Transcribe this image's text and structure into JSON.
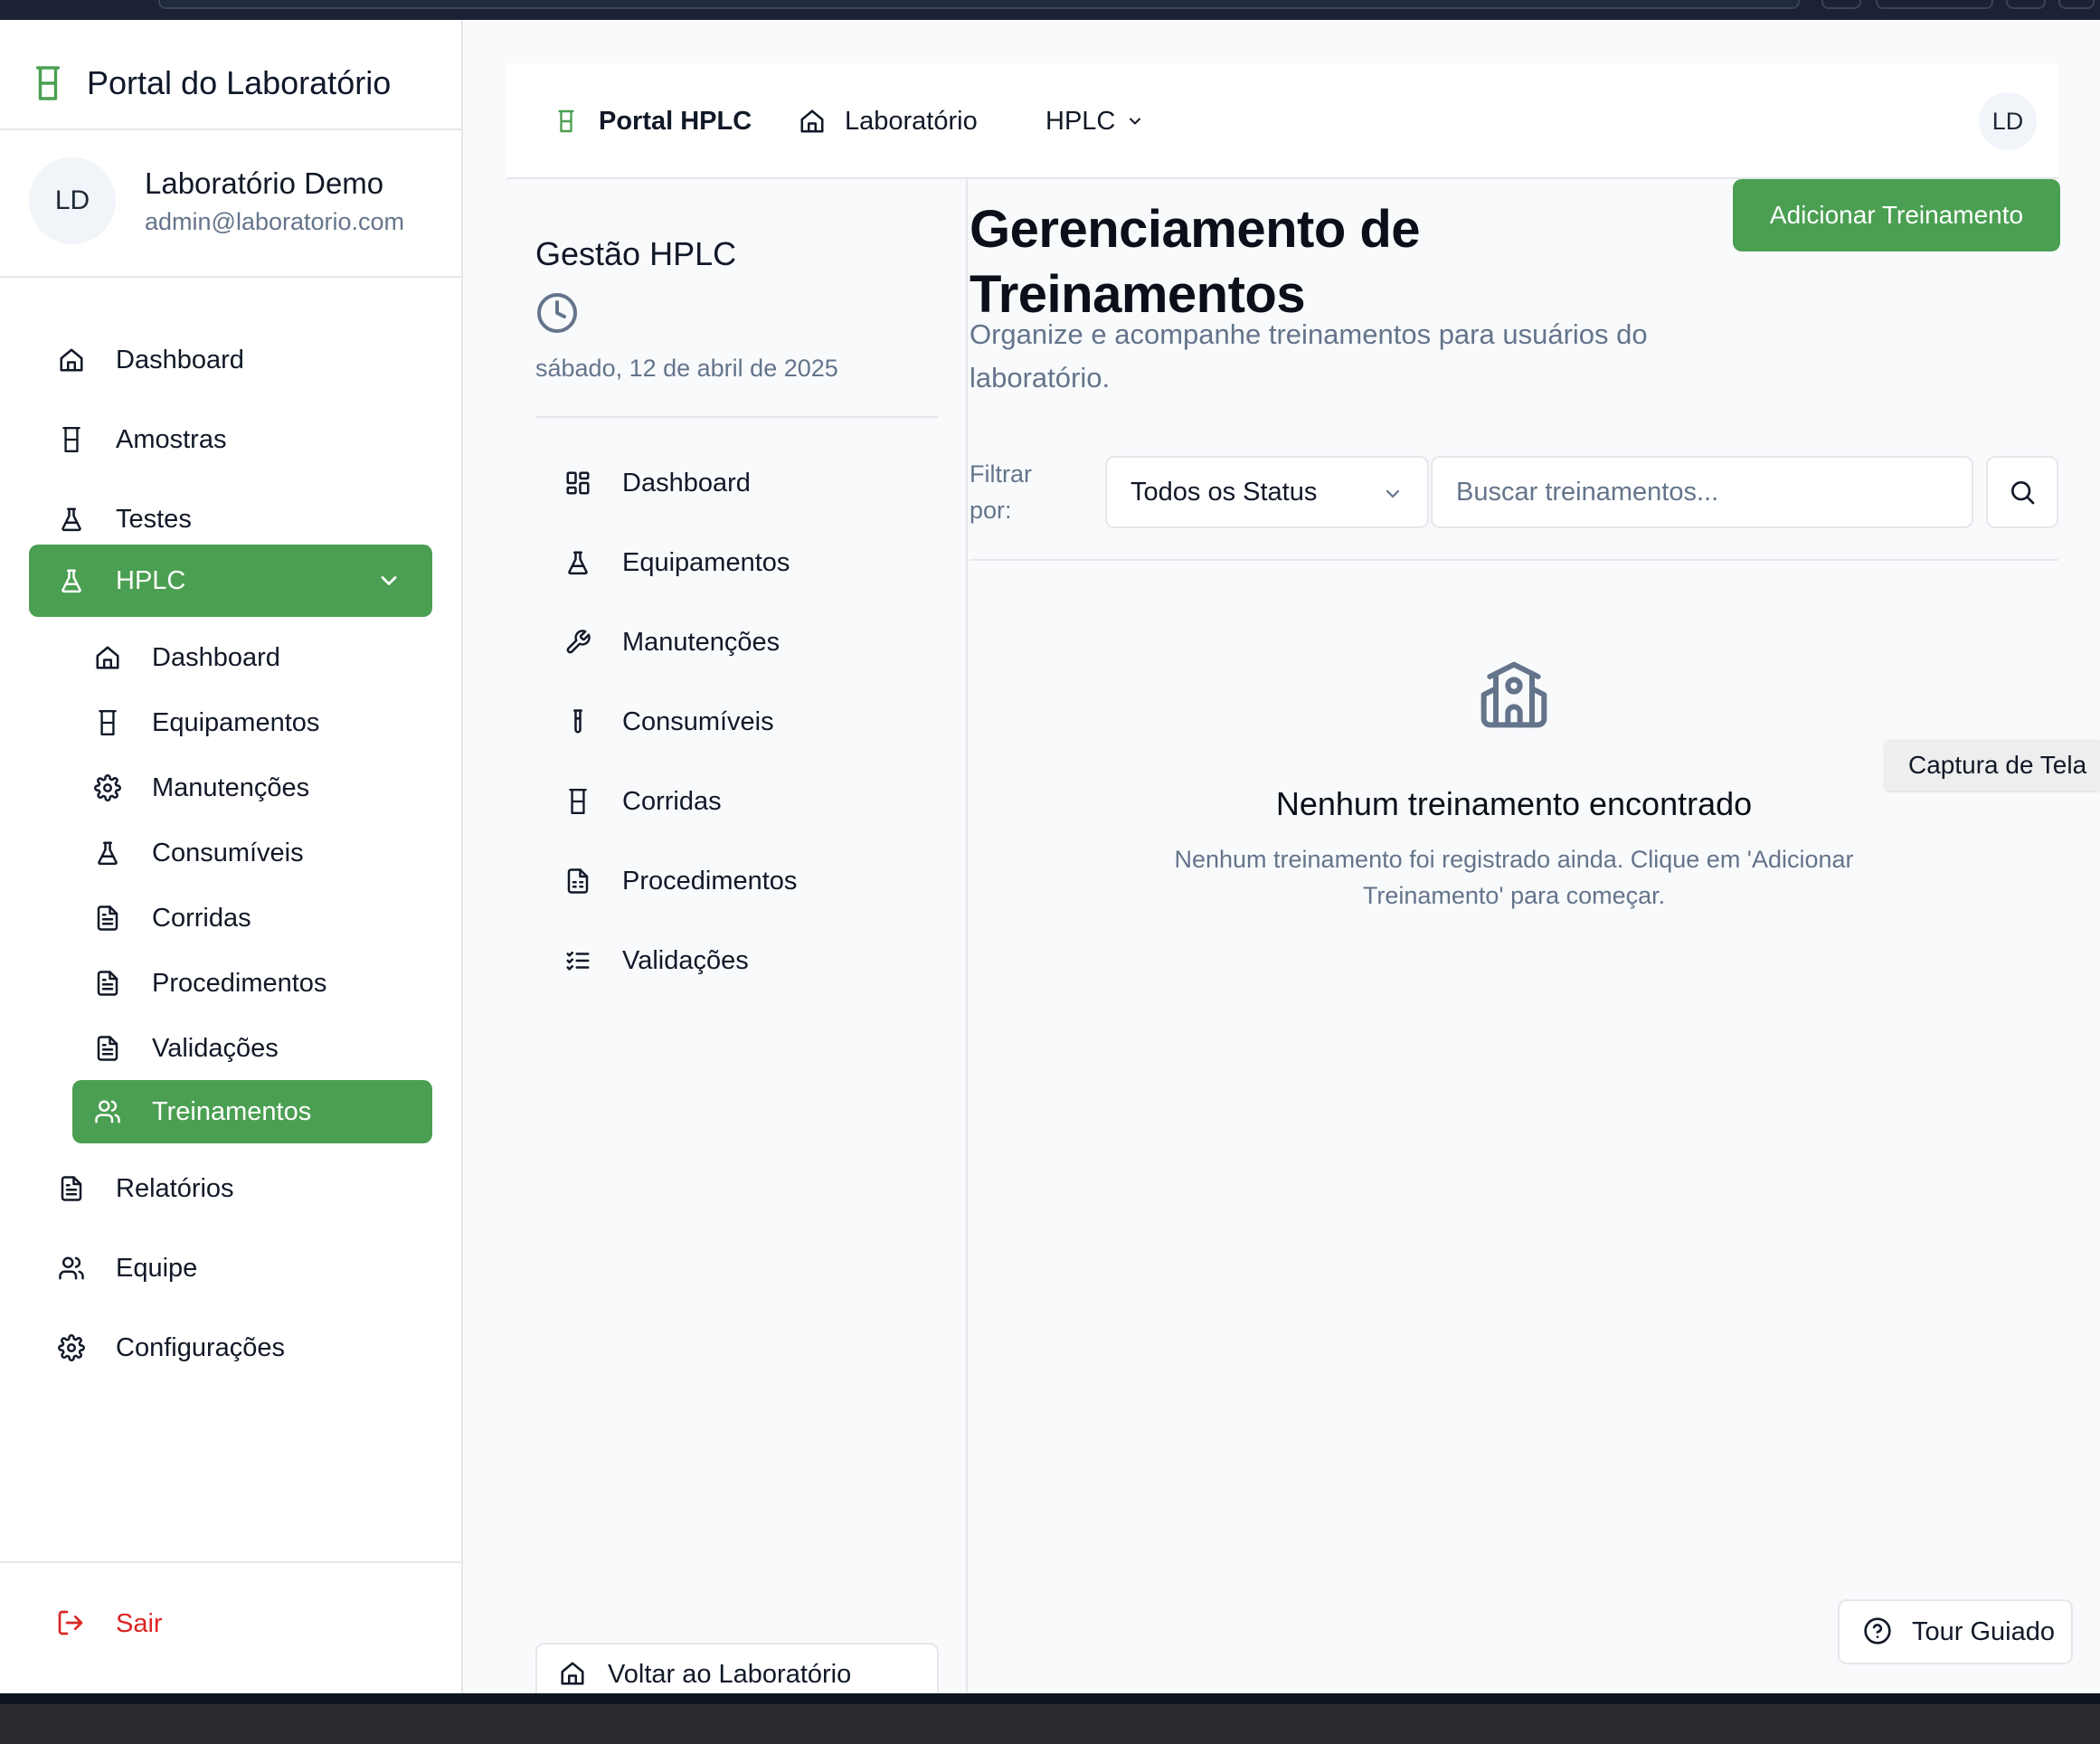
{
  "sidebar": {
    "brand": "Portal do Laboratório",
    "user": {
      "initials": "LD",
      "name": "Laboratório Demo",
      "email": "admin@laboratorio.com"
    },
    "nav": [
      {
        "label": "Dashboard",
        "icon": "home-icon"
      },
      {
        "label": "Amostras",
        "icon": "beaker-icon"
      },
      {
        "label": "Testes",
        "icon": "flask-icon"
      },
      {
        "label": "HPLC",
        "icon": "flask-icon",
        "active": true,
        "expanded": true
      }
    ],
    "hplc_sub": [
      {
        "label": "Dashboard",
        "icon": "home-icon"
      },
      {
        "label": "Equipamentos",
        "icon": "beaker-icon"
      },
      {
        "label": "Manutenções",
        "icon": "gear-icon"
      },
      {
        "label": "Consumíveis",
        "icon": "flask-icon"
      },
      {
        "label": "Corridas",
        "icon": "document-icon"
      },
      {
        "label": "Procedimentos",
        "icon": "document-icon"
      },
      {
        "label": "Validações",
        "icon": "document-icon"
      },
      {
        "label": "Treinamentos",
        "icon": "users-icon",
        "active": true
      }
    ],
    "nav_bottom": [
      {
        "label": "Relatórios",
        "icon": "document-icon"
      },
      {
        "label": "Equipe",
        "icon": "users-icon"
      },
      {
        "label": "Configurações",
        "icon": "gear-icon"
      }
    ],
    "logout": "Sair"
  },
  "header": {
    "brand": "Portal HPLC",
    "lab_link": "Laboratório",
    "hplc_menu": "HPLC",
    "avatar": "LD"
  },
  "secondary": {
    "title": "Gestão HPLC",
    "date": "sábado, 12 de abril de 2025",
    "items": [
      {
        "label": "Dashboard",
        "icon": "grid-icon"
      },
      {
        "label": "Equipamentos",
        "icon": "flask-icon"
      },
      {
        "label": "Manutenções",
        "icon": "wrench-icon"
      },
      {
        "label": "Consumíveis",
        "icon": "test-tube-icon"
      },
      {
        "label": "Corridas",
        "icon": "beaker-icon"
      },
      {
        "label": "Procedimentos",
        "icon": "file-spreadsheet-icon"
      },
      {
        "label": "Validações",
        "icon": "list-checks-icon"
      }
    ],
    "back_button": "Voltar ao Laboratório"
  },
  "main": {
    "title": "Gerenciamento de Treinamentos",
    "subtitle": "Organize e acompanhe treinamentos para usuários do laboratório.",
    "add_button": "Adicionar Treinamento",
    "filter_label": "Filtrar por:",
    "status_select": "Todos os Status",
    "search_placeholder": "Buscar treinamentos...",
    "empty_title": "Nenhum treinamento encontrado",
    "empty_desc": "Nenhum treinamento foi registrado ainda. Clique em 'Adicionar Treinamento' para começar."
  },
  "overlay": {
    "screenshot_label": "Captura de Tela",
    "tour_button": "Tour Guiado"
  },
  "colors": {
    "accent": "#4b9f52",
    "danger": "#dc2626",
    "muted": "#64748b"
  }
}
